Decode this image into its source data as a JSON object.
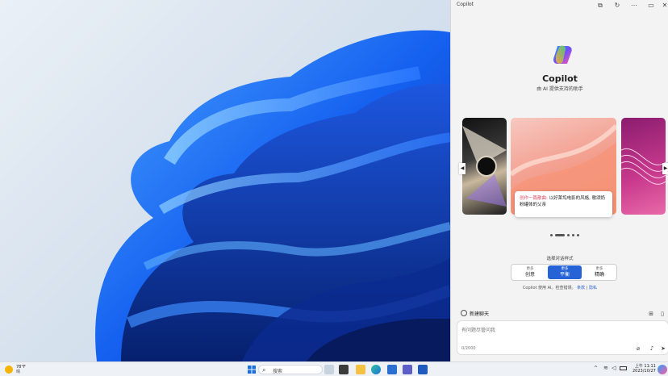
{
  "copilot": {
    "window_title": "Copilot",
    "brand": "Copilot",
    "tagline": "由 AI 提供支持的助手",
    "caption_highlight": "创作一篇散曲:",
    "caption_body": "以好莱坞电影的风格, 歌颂奶粉罐体的父亲",
    "style_label": "选择对话样式",
    "styles": [
      {
        "small": "更多",
        "label": "创意"
      },
      {
        "small": "更多",
        "label": "平衡"
      },
      {
        "small": "更多",
        "label": "精确"
      }
    ],
    "active_style": "平衡",
    "notice_text": "Copilot 使用 AI。检查错误。",
    "notice_terms": "条款",
    "notice_sep": "|",
    "notice_privacy": "隐私",
    "new_chat": "新建聊天",
    "input_placeholder": "有问题尽管问我",
    "char_counter": "0/2000"
  },
  "taskbar": {
    "weather_temp": "78°F",
    "weather_desc": "晴",
    "search_label": "搜索",
    "time": "上午 11:11",
    "date": "2023/10/27"
  },
  "colors": {
    "accent": "#2563d6",
    "highlight": "#d94c63",
    "link": "#2b63c8"
  },
  "icons": [
    "windows-start-icon",
    "search-icon",
    "taskview-icon",
    "explorer-icon",
    "edge-icon",
    "store-icon",
    "teams-icon",
    "word-icon",
    "copilot-icon",
    "wifi-icon",
    "volume-icon",
    "battery-icon"
  ]
}
